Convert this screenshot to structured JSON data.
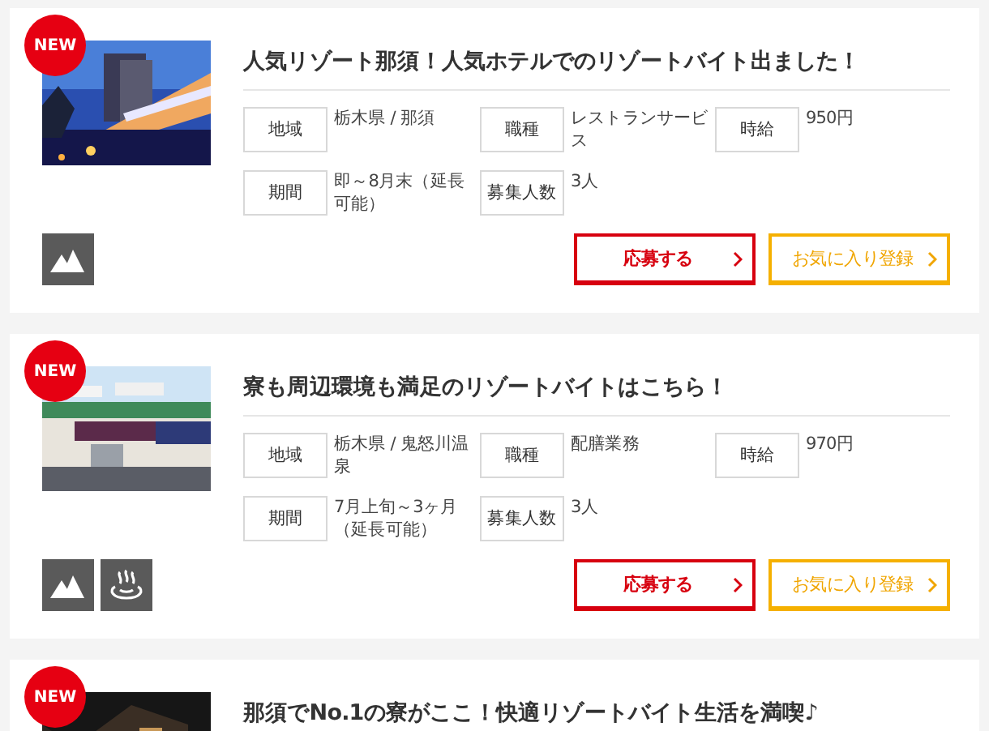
{
  "jobs": [
    {
      "badge": "NEW",
      "picture": {
        "kind": "picture"
      },
      "title": "人気リゾート那須！人気ホテルでのリゾートバイト出ました！",
      "specs": [
        {
          "label": "地域",
          "value": "栃木県 / 那須"
        },
        {
          "label": "職種",
          "value": "レストランサービス"
        },
        {
          "label": "時給",
          "value": "950円"
        },
        {
          "label": "期間",
          "value": "即～8月末（延長可能）"
        },
        {
          "label": "募集人数",
          "value": "3人"
        }
      ],
      "tags": [
        {
          "kind": "mountain"
        }
      ],
      "buttons": [
        {
          "kind": "apply",
          "label": "応募する"
        },
        {
          "kind": "favorite",
          "label": "お気に入り登録"
        }
      ]
    },
    {
      "badge": "NEW",
      "picture": {
        "kind": "picture"
      },
      "title": "寮も周辺環境も満足のリゾートバイトはこちら！",
      "specs": [
        {
          "label": "地域",
          "value": "栃木県 / 鬼怒川温泉"
        },
        {
          "label": "職種",
          "value": "配膳業務"
        },
        {
          "label": "時給",
          "value": "970円"
        },
        {
          "label": "期間",
          "value": "7月上旬～3ヶ月（延長可能）"
        },
        {
          "label": "募集人数",
          "value": "3人"
        }
      ],
      "tags": [
        {
          "kind": "mountain"
        },
        {
          "kind": "onsen"
        }
      ],
      "buttons": [
        {
          "kind": "apply",
          "label": "応募する"
        },
        {
          "kind": "favorite",
          "label": "お気に入り登録"
        }
      ]
    },
    {
      "badge": "NEW",
      "picture": {
        "kind": "picture"
      },
      "title": "那須でNo.1の寮がここ！快適リゾートバイト生活を満喫♪"
    }
  ]
}
